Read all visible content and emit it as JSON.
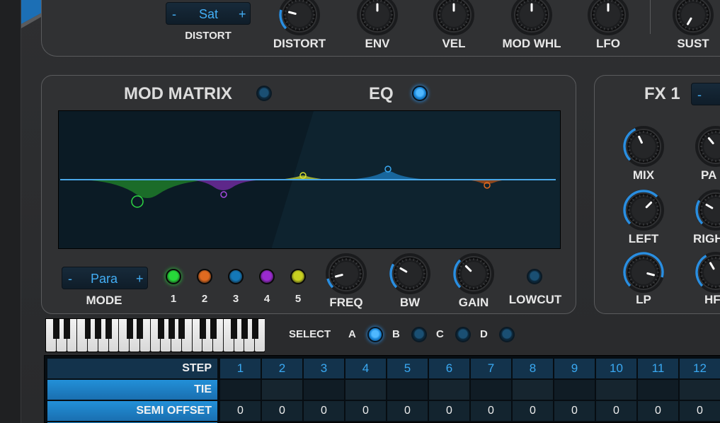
{
  "top": {
    "distort_select": "Sat",
    "distort_select_minus": "-",
    "distort_select_plus": "+",
    "distort_label": "DISTORT",
    "knobs": [
      "DISTORT",
      "ENV",
      "VEL",
      "MOD WHL",
      "LFO",
      "SUST"
    ]
  },
  "eq_panel": {
    "mod_matrix_title": "MOD MATRIX",
    "eq_title": "EQ",
    "mode_value": "Para",
    "mode_minus": "-",
    "mode_plus": "+",
    "mode_label": "MODE",
    "bands": [
      {
        "label": "1",
        "color": "#27d83a"
      },
      {
        "label": "2",
        "color": "#e06a20"
      },
      {
        "label": "3",
        "color": "#1478b8"
      },
      {
        "label": "4",
        "color": "#9a2ad0"
      },
      {
        "label": "5",
        "color": "#c8d020"
      }
    ],
    "knobs": [
      "FREQ",
      "BW",
      "GAIN"
    ],
    "lowcut_label": "LOWCUT"
  },
  "fx_panel": {
    "title": "FX 1",
    "select_minus": "-",
    "knobs": [
      "MIX",
      "PA",
      "LEFT",
      "RIGH",
      "LP",
      "HF"
    ]
  },
  "select_row": {
    "label": "SELECT",
    "options": [
      "A",
      "B",
      "C",
      "D"
    ],
    "active": "A"
  },
  "step_grid": {
    "step_label": "STEP",
    "steps": [
      "1",
      "2",
      "3",
      "4",
      "5",
      "6",
      "7",
      "8",
      "9",
      "10",
      "11",
      "12"
    ],
    "tie_label": "TIE",
    "semi_label": "SEMI OFFSET",
    "semi_values": [
      "0",
      "0",
      "0",
      "0",
      "0",
      "0",
      "0",
      "0",
      "0",
      "0",
      "0",
      "0"
    ]
  },
  "colors": {
    "accent_blue": "#2a9cff",
    "panel": "#303133",
    "eq_bg": "#0b1b25"
  }
}
